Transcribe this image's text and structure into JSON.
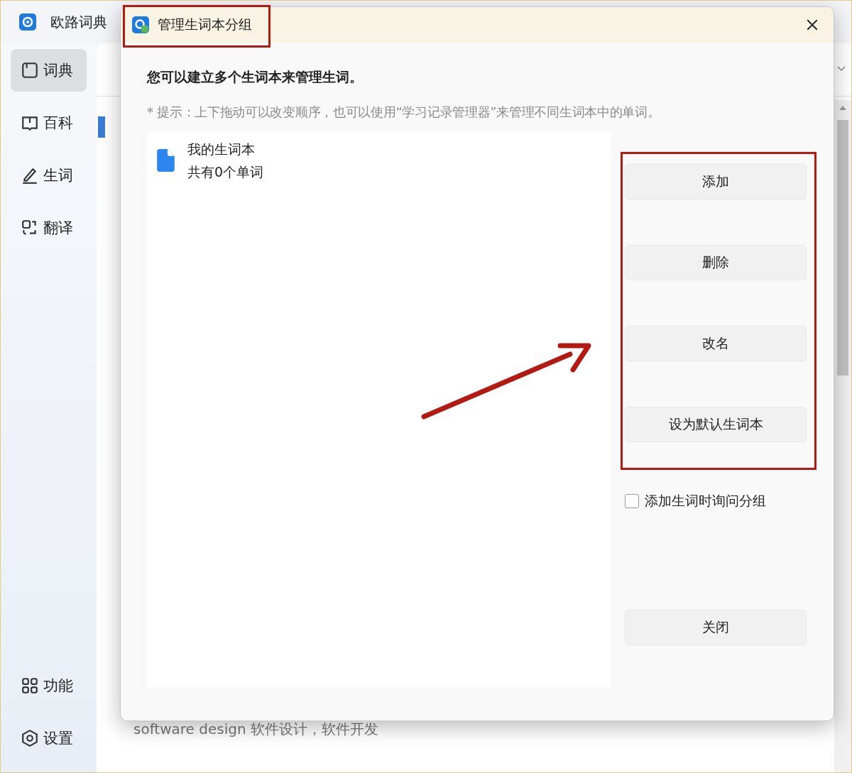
{
  "app": {
    "title": "欧路词典"
  },
  "sidebar": {
    "items": [
      {
        "label": "词典",
        "selected": true
      },
      {
        "label": "百科",
        "selected": false
      },
      {
        "label": "生词",
        "selected": false
      },
      {
        "label": "翻译",
        "selected": false
      }
    ],
    "bottom_items": [
      {
        "label": "功能"
      },
      {
        "label": "设置"
      }
    ]
  },
  "background_text": "software design 软件设计，软件开发",
  "dialog": {
    "title": "管理生词本分组",
    "heading": "您可以建立多个生词本来管理生词。",
    "hint": "* 提示：上下拖动可以改变顺序，也可以使用“学习记录管理器”来管理不同生词本中的单词。",
    "wordbooks": [
      {
        "name": "我的生词本",
        "count": "共有0个单词"
      }
    ],
    "buttons": [
      "添加",
      "删除",
      "改名",
      "设为默认生词本"
    ],
    "ask_group": {
      "label": "添加生词时询问分组",
      "checked": false
    },
    "close_button": "关闭"
  }
}
